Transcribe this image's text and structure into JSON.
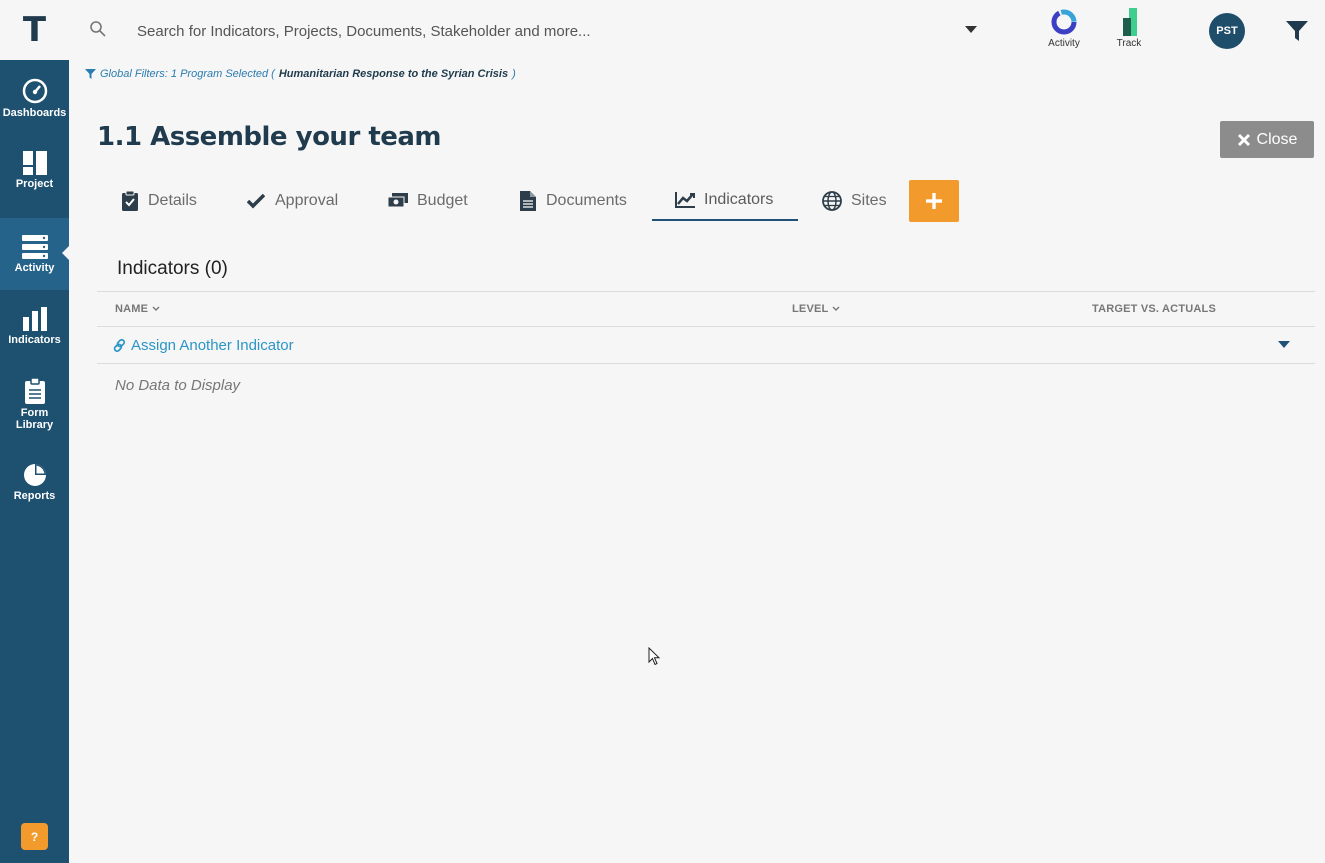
{
  "header": {
    "logo": "T",
    "search": {
      "placeholder": "Search for Indicators, Projects, Documents, Stakeholder and more..."
    },
    "apps": [
      {
        "label": "Activity",
        "icon": "activity-ring-icon"
      },
      {
        "label": "Track",
        "icon": "track-bars-icon"
      }
    ],
    "avatar": "PST",
    "filter_icon": "funnel-icon"
  },
  "sidebar": {
    "items": [
      {
        "label": "Dashboards",
        "icon": "dashboard-gauge-icon"
      },
      {
        "label": "Project",
        "icon": "project-grid-icon"
      },
      {
        "label": "Activity",
        "icon": "activity-server-icon",
        "active": true
      },
      {
        "label": "Indicators",
        "icon": "bar-chart-icon"
      },
      {
        "label": "Form Library",
        "icon": "clipboard-icon"
      },
      {
        "label": "Reports",
        "icon": "pie-chart-icon"
      }
    ],
    "help": "?"
  },
  "global_filter": {
    "prefix": "Global Filters: 1 Program Selected (",
    "program": "Humanitarian Response to the Syrian Crisis",
    "suffix": ")"
  },
  "page": {
    "title": "1.1 Assemble your team",
    "close_label": "Close"
  },
  "tabs": [
    {
      "label": "Details",
      "icon": "clipboard-check-icon"
    },
    {
      "label": "Approval",
      "icon": "checkmark-icon"
    },
    {
      "label": "Budget",
      "icon": "money-icon"
    },
    {
      "label": "Documents",
      "icon": "document-icon"
    },
    {
      "label": "Indicators",
      "icon": "line-chart-icon",
      "active": true
    },
    {
      "label": "Sites",
      "icon": "globe-icon"
    }
  ],
  "indicators": {
    "heading": "Indicators (0)",
    "columns": [
      "NAME",
      "LEVEL",
      "TARGET VS. ACTUALS"
    ],
    "assign_label": "Assign Another Indicator",
    "empty_text": "No Data to Display"
  },
  "colors": {
    "sidebar": "#1e5170",
    "sidebar_active": "#25638a",
    "accent_orange": "#f39a2c",
    "link_blue": "#2b95c8",
    "title_navy": "#1f3b4d"
  }
}
